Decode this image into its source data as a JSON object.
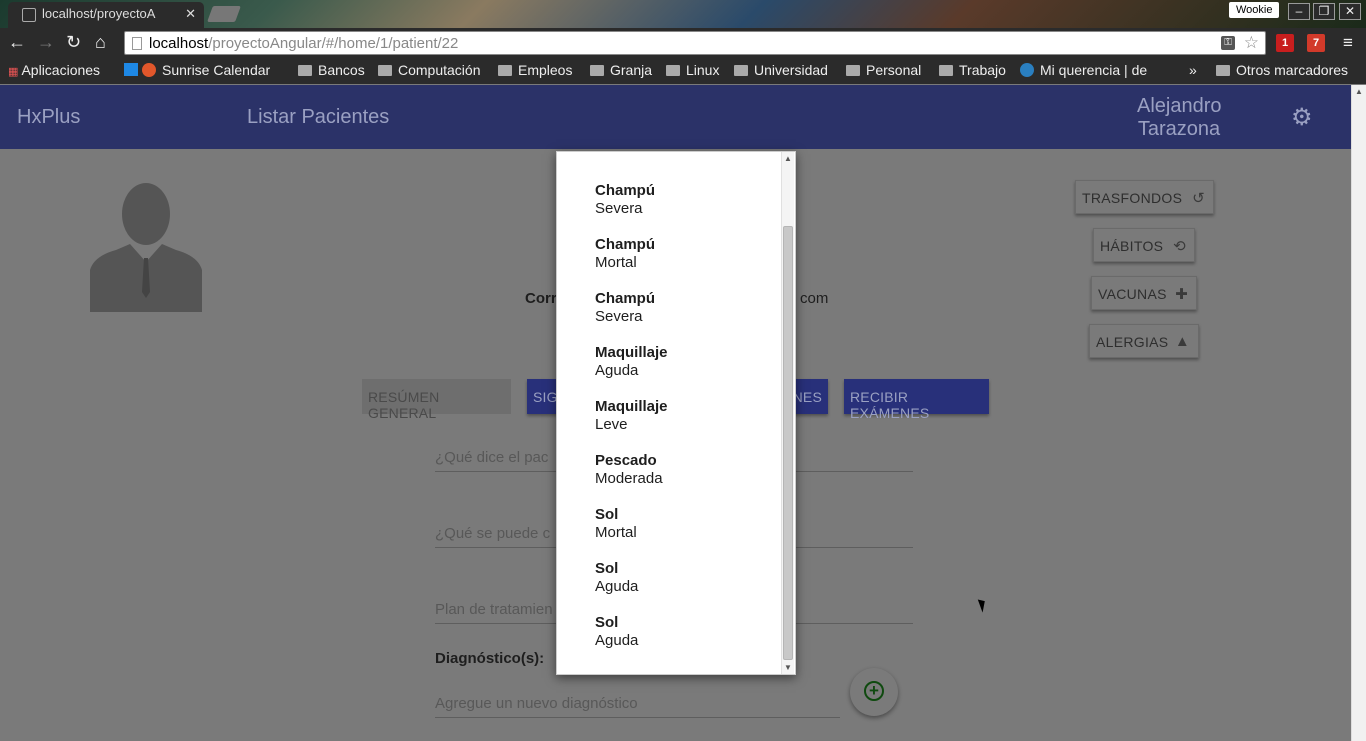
{
  "browser": {
    "tab_title": "localhost/proyectoA",
    "profile_name": "Wookie",
    "url_host": "localhost",
    "url_path": "/proyectoAngular/#/home/1/patient/22",
    "bookmarks": [
      "Aplicaciones",
      "Sunrise Calendar",
      "Bancos",
      "Computación",
      "Empleos",
      "Granja",
      "Linux",
      "Universidad",
      "Personal",
      "Trabajo",
      "Mi querencia | de"
    ],
    "other_bookmarks": "Otros marcadores",
    "ext_badge_1": "1",
    "ext_badge_2": "7",
    "chevron": "»"
  },
  "app": {
    "brand": "HxPlus",
    "nav_link": "Listar Pacientes",
    "user_first": "Alejandro",
    "user_last": "Tarazona",
    "accent_color": "#2b3268"
  },
  "patient": {
    "email_label": "Corr",
    "email_tail": "com"
  },
  "side_buttons": {
    "backgrounds": "TRASFONDOS",
    "habits": "HÁBITOS",
    "vaccines": "VACUNAS",
    "allergies": "ALERGIAS"
  },
  "tabs": {
    "summary": "RESÚMEN GENERAL",
    "signs": "SIG",
    "exams_tail": "NES",
    "receive_exams": "RECIBIR EXÁMENES"
  },
  "form": {
    "subjective_placeholder": "¿Qué dice el pac",
    "objective_placeholder": "¿Qué se puede c",
    "plan_placeholder": "Plan de tratamien",
    "diagnosis_label": "Diagnóstico(s):",
    "new_diagnosis_placeholder": "Agregue un nuevo diagnóstico"
  },
  "dropdown": {
    "items": [
      {
        "name": "Champú",
        "severity": "Severa"
      },
      {
        "name": "Champú",
        "severity": "Mortal"
      },
      {
        "name": "Champú",
        "severity": "Severa"
      },
      {
        "name": "Maquillaje",
        "severity": "Aguda"
      },
      {
        "name": "Maquillaje",
        "severity": "Leve"
      },
      {
        "name": "Pescado",
        "severity": "Moderada"
      },
      {
        "name": "Sol",
        "severity": "Mortal"
      },
      {
        "name": "Sol",
        "severity": "Aguda"
      },
      {
        "name": "Sol",
        "severity": "Aguda"
      }
    ]
  }
}
